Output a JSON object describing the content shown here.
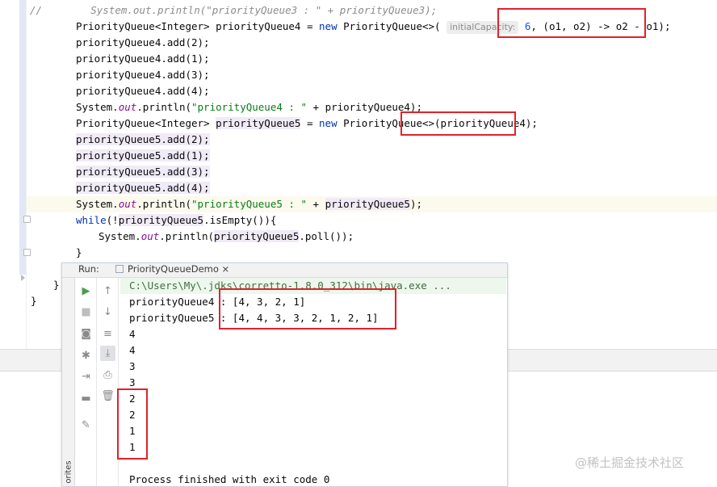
{
  "editor": {
    "comment_line": "//        System.out.println(\"priorityQueue3 : \" + priorityQueue3);",
    "l1_a": "PriorityQueue<Integer> priorityQueue4 = ",
    "l1_new": "new",
    "l1_b": " PriorityQueue<>( ",
    "l1_hint": "initialCapacity:",
    "l1_num": "6",
    "l1_c": ", (o1, o2) -> o2 - o1);",
    "l2": "priorityQueue4.add(2);",
    "l3": "priorityQueue4.add(1);",
    "l4": "priorityQueue4.add(3);",
    "l5": "priorityQueue4.add(4);",
    "l6_a": "System.",
    "l6_out": "out",
    "l6_b": ".println(",
    "l6_str": "\"priorityQueue4 : \"",
    "l6_c": " + priorityQueue4);",
    "l7_a": "PriorityQueue<Integer> ",
    "l7_var": "priorityQueue5",
    "l7_b": " = ",
    "l7_new": "new",
    "l7_c": " PriorityQueue<>(priorityQueue4);",
    "l8": "priorityQueue5.add(2);",
    "l9": "priorityQueue5.add(1);",
    "l10": "priorityQueue5.add(3);",
    "l11": "priorityQueue5.add(4);",
    "l12_a": "System.",
    "l12_out": "out",
    "l12_b": ".println(",
    "l12_str": "\"priorityQueue5 : \"",
    "l12_c": " + ",
    "l12_var": "priorityQueue5",
    "l12_d": ");",
    "l13_kw": "while",
    "l13_a": "(!",
    "l13_var": "priorityQueue5",
    "l13_b": ".isEmpty()){",
    "l14_a": "System.",
    "l14_out": "out",
    "l14_b": ".println(",
    "l14_var": "priorityQueue5",
    "l14_c": ".poll());",
    "l15": "}",
    "l16": "}",
    "l17": "}"
  },
  "run_panel": {
    "run_label": "Run:",
    "tab_label": "PriorityQueueDemo",
    "side_tab": "orites",
    "console": {
      "command": "C:\\Users\\My\\.jdks\\corretto-1.8.0_312\\bin\\java.exe ...",
      "lines": [
        "priorityQueue4 : [4, 3, 2, 1]",
        "priorityQueue5 : [4, 4, 3, 3, 2, 1, 2, 1]",
        "4",
        "4",
        "3",
        "3",
        "2",
        "2",
        "1",
        "1",
        "",
        "Process finished with exit code 0"
      ]
    }
  },
  "watermark": "@稀土掘金技术社区",
  "colors": {
    "annotation_red": "#e0222a",
    "keyword": "#0033b3",
    "string": "#067d17",
    "static_field": "#871094"
  }
}
